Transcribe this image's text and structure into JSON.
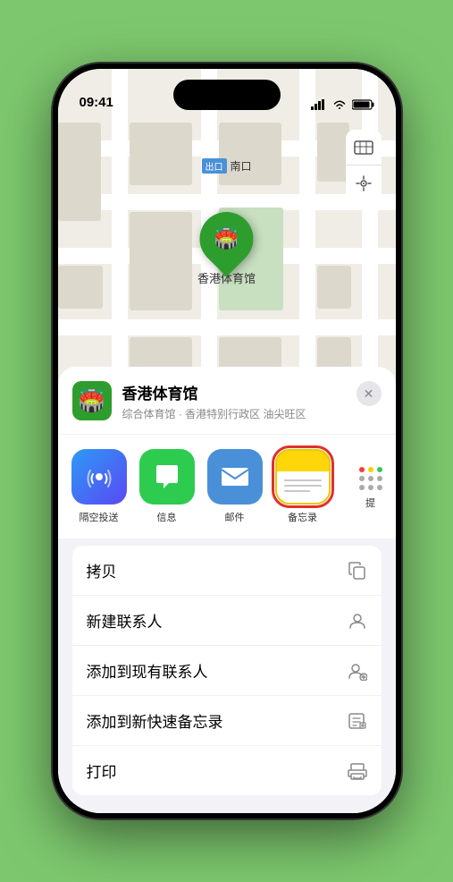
{
  "status": {
    "time": "09:41",
    "signal_bars": "▌▌▌",
    "wifi": "wifi",
    "battery": "battery"
  },
  "map": {
    "label_tag": "出口",
    "label_text": "南口",
    "pin_label": "香港体育馆",
    "pin_emoji": "🏟️"
  },
  "map_controls": {
    "map_icon": "🗺",
    "location_icon": "➤"
  },
  "location_card": {
    "icon": "🏟️",
    "name": "香港体育馆",
    "description": "综合体育馆 · 香港特别行政区 油尖旺区",
    "close_label": "✕"
  },
  "share_items": [
    {
      "id": "airdrop",
      "label": "隔空投送",
      "icon_type": "airdrop",
      "symbol": "📡"
    },
    {
      "id": "messages",
      "label": "信息",
      "icon_type": "messages",
      "symbol": "💬"
    },
    {
      "id": "mail",
      "label": "邮件",
      "icon_type": "mail",
      "symbol": "✉️"
    },
    {
      "id": "notes",
      "label": "备忘录",
      "icon_type": "notes",
      "selected": true
    },
    {
      "id": "more",
      "label": "提",
      "icon_type": "more",
      "symbol": "⋯"
    }
  ],
  "actions": [
    {
      "id": "copy",
      "label": "拷贝",
      "icon": "copy"
    },
    {
      "id": "new-contact",
      "label": "新建联系人",
      "icon": "person"
    },
    {
      "id": "add-existing",
      "label": "添加到现有联系人",
      "icon": "person-add"
    },
    {
      "id": "quick-note",
      "label": "添加到新快速备忘录",
      "icon": "note"
    },
    {
      "id": "print",
      "label": "打印",
      "icon": "printer"
    }
  ]
}
